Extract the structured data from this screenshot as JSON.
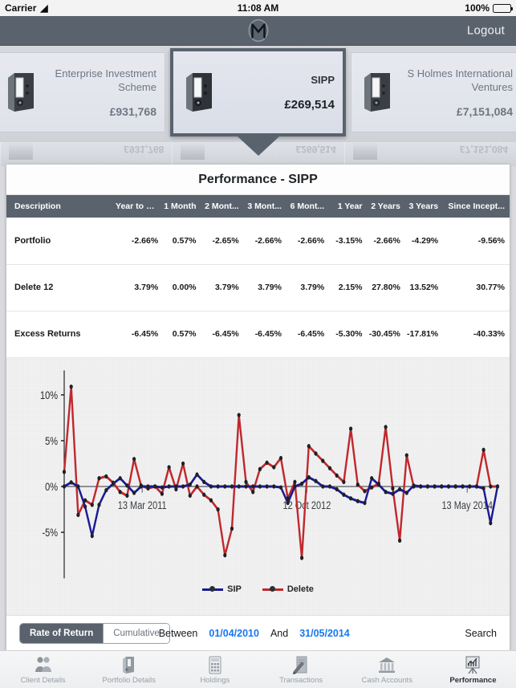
{
  "status_bar": {
    "carrier": "Carrier",
    "wifi_icon": "wifi-icon",
    "time": "11:08 AM",
    "battery_pct": "100%"
  },
  "nav": {
    "logo_icon": "app-logo-m-icon",
    "logout_label": "Logout"
  },
  "portfolio_cards": [
    {
      "name": "Enterprise Investment Scheme",
      "value": "£931,768",
      "selected": false
    },
    {
      "name": "SIPP",
      "value": "£269,514",
      "selected": true
    },
    {
      "name": "S Holmes International Ventures",
      "value": "£7,151,084",
      "selected": false
    }
  ],
  "panel": {
    "title": "Performance - SIPP"
  },
  "table": {
    "columns": [
      "Description",
      "Year to D...",
      "1 Month",
      "2 Mont...",
      "3 Mont...",
      "6 Mont...",
      "1 Year",
      "2 Years",
      "3 Years",
      "Since Incept..."
    ],
    "rows": [
      {
        "description": "Portfolio",
        "values": [
          "-2.66%",
          "0.57%",
          "-2.65%",
          "-2.66%",
          "-2.66%",
          "-3.15%",
          "-2.66%",
          "-4.29%",
          "-9.56%"
        ]
      },
      {
        "description": "Delete 12",
        "values": [
          "3.79%",
          "0.00%",
          "3.79%",
          "3.79%",
          "3.79%",
          "2.15%",
          "27.80%",
          "13.52%",
          "30.77%"
        ]
      },
      {
        "description": "Excess Returns",
        "values": [
          "-6.45%",
          "0.57%",
          "-6.45%",
          "-6.45%",
          "-6.45%",
          "-5.30%",
          "-30.45%",
          "-17.81%",
          "-40.33%"
        ]
      }
    ]
  },
  "chart_data": {
    "type": "line",
    "title": "",
    "xlabel": "",
    "ylabel": "",
    "ylim": [
      -8,
      12
    ],
    "ytick_labels": [
      "10%",
      "5%",
      "0%",
      "-5%"
    ],
    "ytick_values": [
      10,
      5,
      0,
      -5
    ],
    "xtick_labels": [
      "13 Mar 2011",
      "12 Oct 2012",
      "13 May 2014"
    ],
    "xtick_positions": [
      0.18,
      0.56,
      0.93
    ],
    "grid": false,
    "legend_position": "bottom",
    "series": [
      {
        "name": "SIP",
        "color": "#1a1a96",
        "values": [
          0.0,
          0.45,
          0.0,
          -2.2,
          -5.4,
          -2.0,
          -0.4,
          0.3,
          0.9,
          0.1,
          -0.7,
          0.0,
          0.0,
          0.0,
          -0.1,
          0.0,
          0.0,
          0.0,
          0.2,
          1.3,
          0.5,
          0.0,
          0.0,
          0.0,
          0.0,
          0.0,
          0.0,
          0.0,
          0.0,
          0.0,
          0.0,
          -0.1,
          -1.8,
          0.0,
          0.3,
          1.0,
          0.6,
          0.0,
          0.0,
          -0.3,
          -0.9,
          -1.3,
          -1.6,
          -1.8,
          0.9,
          0.2,
          -0.6,
          -0.8,
          -0.3,
          -0.7,
          0.1,
          0.0,
          0.0,
          0.0,
          0.0,
          0.0,
          0.0,
          0.0,
          0.0,
          0.0,
          -0.2,
          -4.0,
          0.0
        ]
      },
      {
        "name": "Delete",
        "color": "#c0282d",
        "values": [
          1.6,
          10.9,
          -3.1,
          -1.5,
          -2.0,
          0.9,
          1.1,
          0.4,
          -0.6,
          -1.0,
          3.0,
          0.1,
          -0.2,
          0.0,
          -0.8,
          2.1,
          -0.3,
          2.5,
          -1.0,
          0.0,
          -0.9,
          -1.5,
          -2.5,
          -7.5,
          -4.6,
          7.8,
          0.5,
          -0.6,
          1.9,
          2.6,
          2.1,
          3.1,
          -1.3,
          0.5,
          -7.8,
          4.4,
          3.6,
          2.8,
          2.0,
          1.2,
          0.5,
          6.3,
          0.2,
          -0.5,
          -0.1,
          0.3,
          6.5,
          -0.2,
          -5.9,
          3.4,
          0.0,
          0.0,
          0.0,
          0.0,
          0.0,
          0.0,
          0.0,
          0.0,
          0.0,
          0.0,
          4.0,
          0.0,
          0.0
        ]
      }
    ]
  },
  "controls": {
    "mode_options": [
      "Rate of Return",
      "Cumulative"
    ],
    "mode_selected": "Rate of Return",
    "between_label": "Between",
    "date_from": "01/04/2010",
    "and_label": "And",
    "date_to": "31/05/2014",
    "search_label": "Search"
  },
  "tabbar": {
    "items": [
      {
        "label": "Client Details",
        "icon": "people-icon",
        "active": false
      },
      {
        "label": "Portfolio Details",
        "icon": "binder-icon",
        "active": false
      },
      {
        "label": "Holdings",
        "icon": "calculator-icon",
        "active": false
      },
      {
        "label": "Transactions",
        "icon": "document-pen-icon",
        "active": false
      },
      {
        "label": "Cash Accounts",
        "icon": "bank-icon",
        "active": false
      },
      {
        "label": "Performance",
        "icon": "chart-easel-icon",
        "active": true
      }
    ]
  }
}
